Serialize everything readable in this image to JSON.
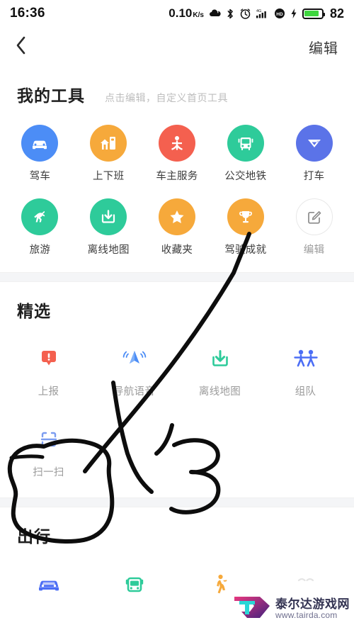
{
  "status_bar": {
    "time": "16:36",
    "net_speed": "0.10",
    "net_unit_top": "K",
    "net_unit_bottom": "s",
    "icons": [
      "weather-icon",
      "bluetooth-icon",
      "alarm-clock-icon",
      "signal-4g-icon",
      "hd-icon",
      "charging-bolt-icon"
    ],
    "battery_percent": "82",
    "battery_fill_color": "#3fd63f"
  },
  "nav_bar": {
    "back_glyph": "‹",
    "back_name": "back-button",
    "action_label": "编辑"
  },
  "my_tools": {
    "title": "我的工具",
    "hint": "点击编辑，自定义首页工具",
    "items": [
      {
        "label": "驾车",
        "icon": "car-icon",
        "bg": "#4c8df6",
        "style": "circle"
      },
      {
        "label": "上下班",
        "icon": "home-work-icon",
        "bg": "#f6a93b",
        "style": "circle"
      },
      {
        "label": "车主服务",
        "icon": "car-owner-service-icon",
        "bg": "#f4604f",
        "style": "circle"
      },
      {
        "label": "公交地铁",
        "icon": "bus-icon",
        "bg": "#2ecb9a",
        "style": "circle"
      },
      {
        "label": "打车",
        "icon": "taxi-hail-icon",
        "bg": "#5b73e8",
        "style": "circle"
      },
      {
        "label": "旅游",
        "icon": "horse-travel-icon",
        "bg": "#2ecb9a",
        "style": "circle"
      },
      {
        "label": "离线地图",
        "icon": "download-map-icon",
        "bg": "#2ecb9a",
        "style": "circle"
      },
      {
        "label": "收藏夹",
        "icon": "star-icon",
        "bg": "#f6a93b",
        "style": "circle"
      },
      {
        "label": "驾驶成就",
        "icon": "trophy-icon",
        "bg": "#f6a93b",
        "style": "circle"
      },
      {
        "label": "编辑",
        "icon": "edit-pencil-icon",
        "bg": "#ffffff",
        "style": "outline"
      }
    ]
  },
  "featured": {
    "title": "精选",
    "items": [
      {
        "label": "上报",
        "icon": "report-alert-icon",
        "color": "#f4604f"
      },
      {
        "label": "导航语音",
        "icon": "navigation-voice-icon",
        "color": "#4c8df6"
      },
      {
        "label": "离线地图",
        "icon": "download-map-icon",
        "color": "#2ecb9a"
      },
      {
        "label": "组队",
        "icon": "team-group-icon",
        "color": "#4c6ef5"
      }
    ],
    "scan_items": [
      {
        "label": "扫一扫",
        "icon": "scan-qr-icon",
        "color": "#7b9cf0"
      }
    ]
  },
  "travel": {
    "title": "出行",
    "items": [
      {
        "label": "",
        "icon": "car-icon",
        "color": "#4c6ef5"
      },
      {
        "label": "",
        "icon": "bus-icon",
        "color": "#2ecb9a"
      },
      {
        "label": "",
        "icon": "walking-person-icon",
        "color": "#f6a93b"
      },
      {
        "label": "",
        "icon": "bike-icon",
        "color": "#dcdcdc"
      }
    ]
  },
  "annotation": {
    "type": "handwritten-ink-overlay",
    "color": "#0a0a0a",
    "shapes": [
      "long-arrow-stroke",
      "circle-around-scan",
      "number-3-stroke"
    ]
  },
  "watermark": {
    "name_cn": "泰尔达游戏网",
    "url": "www.tairda.com",
    "logo": "tairda-logo-icon"
  }
}
